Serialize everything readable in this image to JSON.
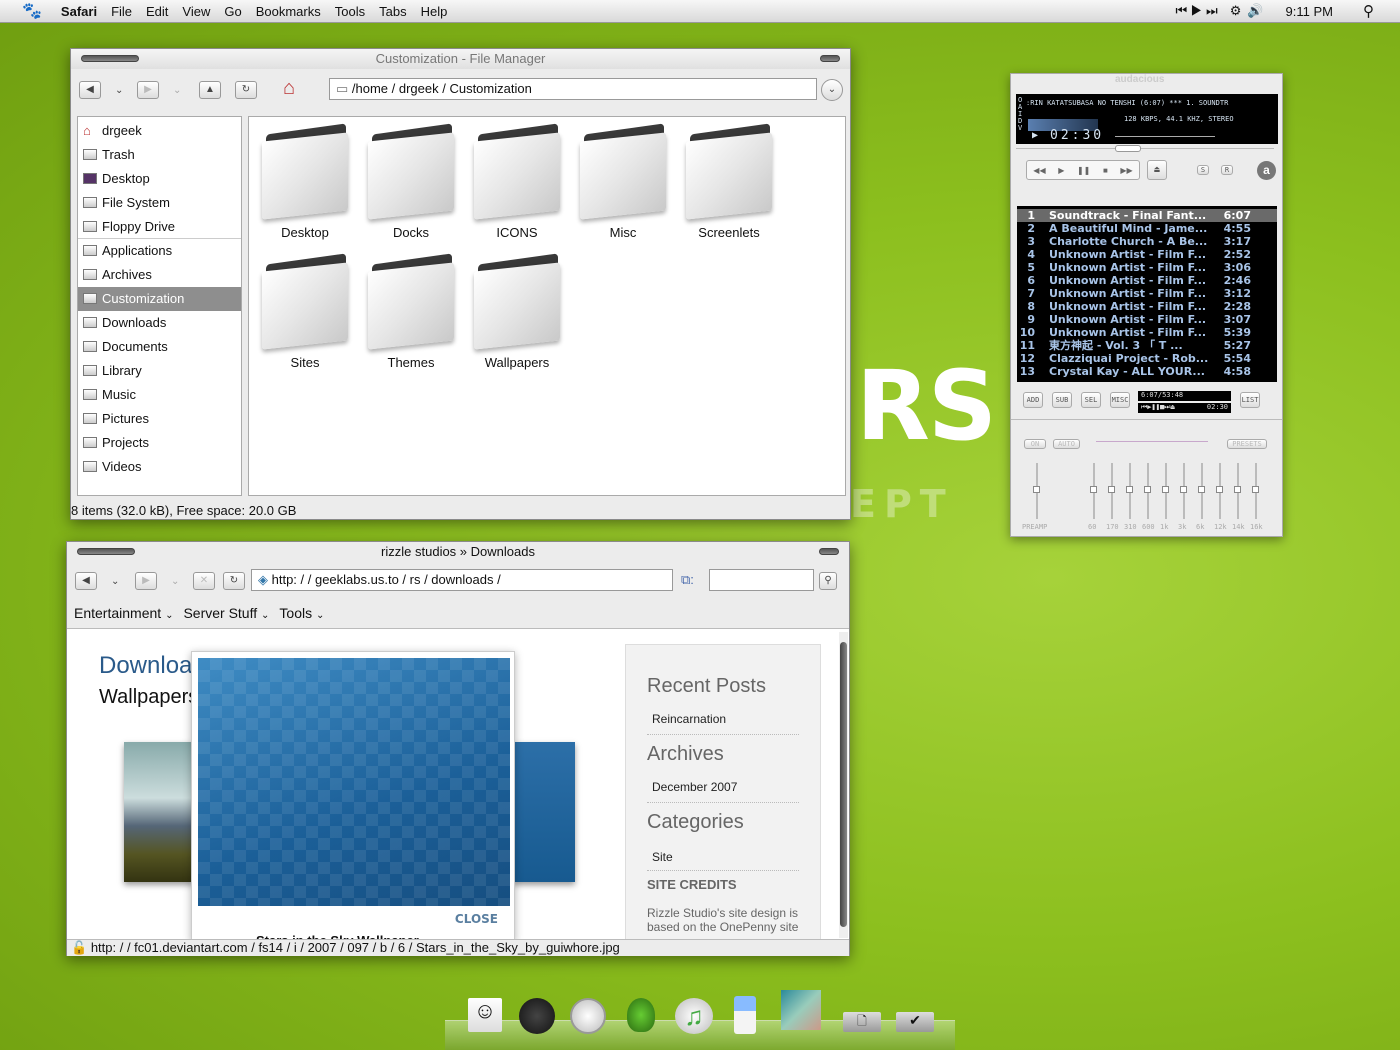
{
  "menubar": {
    "app": "Safari",
    "items": [
      "File",
      "Edit",
      "View",
      "Go",
      "Bookmarks",
      "Tools",
      "Tabs",
      "Help"
    ],
    "clock": "9:11 PM"
  },
  "desktop": {
    "big_text": "RS",
    "sub_text": "EPT"
  },
  "file_manager": {
    "title": "Customization - File Manager",
    "path": "/home / drgeek / Customization",
    "sidebar": [
      "drgeek",
      "Trash",
      "Desktop",
      "File System",
      "Floppy Drive",
      "Applications",
      "Archives",
      "Customization",
      "Downloads",
      "Documents",
      "Library",
      "Music",
      "Pictures",
      "Projects",
      "Videos"
    ],
    "selected": "Customization",
    "folders": [
      "Desktop",
      "Docks",
      "ICONS",
      "Misc",
      "Screenlets",
      "Sites",
      "Themes",
      "Wallpapers"
    ],
    "status": "8 items (32.0 kB), Free space: 20.0 GB"
  },
  "browser": {
    "title": "rizzle studios » Downloads",
    "url": "http: / / geeklabs.us.to / rs / downloads /",
    "search_value": "",
    "bookmarks": [
      "Entertainment",
      "Server Stuff",
      "Tools"
    ],
    "page": {
      "heading": "Downloa",
      "subheading": "Wallpapers",
      "lightbox_close": "CLOSE",
      "lightbox_caption": "Stars in the Sky Wallpaper",
      "sidebar": {
        "recent_title": "Recent Posts",
        "recent": [
          "Reincarnation"
        ],
        "archives_title": "Archives",
        "archives": [
          "December 2007"
        ],
        "categories_title": "Categories",
        "categories": [
          "Site"
        ],
        "credits_title": "SITE CREDITS",
        "credits_text": "Rizzle Studio's site design is based on the OnePenny site"
      }
    },
    "status_url": "http: / / fc01.deviantart.com / fs14 / i / 2007 / 097 / b / 6 / Stars_in_the_Sky_by_guiwhore.jpg"
  },
  "player": {
    "logo": "audacious",
    "marquee": ":RIN KATATSUBASA NO TENSHI (6:07)  ***  1. SOUNDTR",
    "info": "128 KBPS, 44.1 KHZ, STEREO",
    "time": "02:30",
    "side_letters": "OAIDV",
    "playlist": [
      {
        "n": "1",
        "title": "Soundtrack - Final Fant...",
        "dur": "6:07"
      },
      {
        "n": "2",
        "title": "A Beautiful Mind - Jame...",
        "dur": "4:55"
      },
      {
        "n": "3",
        "title": "Charlotte Church - A Be...",
        "dur": "3:17"
      },
      {
        "n": "4",
        "title": "Unknown Artist - Film F...",
        "dur": "2:52"
      },
      {
        "n": "5",
        "title": "Unknown Artist - Film F...",
        "dur": "3:06"
      },
      {
        "n": "6",
        "title": "Unknown Artist - Film F...",
        "dur": "2:46"
      },
      {
        "n": "7",
        "title": "Unknown Artist - Film F...",
        "dur": "3:12"
      },
      {
        "n": "8",
        "title": "Unknown Artist - Film F...",
        "dur": "2:28"
      },
      {
        "n": "9",
        "title": "Unknown Artist - Film F...",
        "dur": "3:07"
      },
      {
        "n": "10",
        "title": "Unknown Artist - Film F...",
        "dur": "5:39"
      },
      {
        "n": "11",
        "title": "東方神起 - Vol. 3 「 T ...",
        "dur": "5:27"
      },
      {
        "n": "12",
        "title": "Clazziquai Project - Rob...",
        "dur": "5:54"
      },
      {
        "n": "13",
        "title": "Crystal Kay - ALL YOUR...",
        "dur": "4:58"
      }
    ],
    "pl_buttons": [
      "ADD",
      "SUB",
      "SEL",
      "MISC",
      "LIST"
    ],
    "pl_time": "6:07/53:48",
    "pl_mini_time": "02:30",
    "eq": {
      "on": "ON",
      "auto": "AUTO",
      "presets": "PRESETS",
      "preamp": "PREAMP",
      "bands": [
        "60",
        "170",
        "310",
        "600",
        "1k",
        "3k",
        "6k",
        "12k",
        "14k",
        "16k"
      ]
    }
  },
  "dock": [
    "finder",
    "dashboard",
    "safari",
    "adium",
    "itunes",
    "ipod",
    "o-noes-image",
    "documents-stack",
    "applications-stack"
  ],
  "colors": {
    "desktop": "#8cbf1e",
    "selection": "#8e8e8e",
    "playlist_text": "#a8c4e8",
    "link": "#2a5a8a"
  }
}
